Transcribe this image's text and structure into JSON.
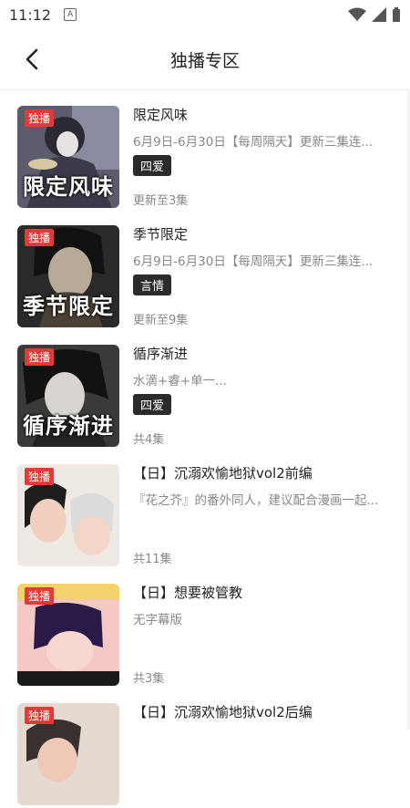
{
  "status": {
    "time": "11:12",
    "a_icon": "A"
  },
  "header": {
    "title": "独播专区"
  },
  "items": [
    {
      "badge": "独播",
      "cover_text": "限定风味",
      "name": "限定风味",
      "desc": "6月9日-6月30日【每周隔天】更新三集连...",
      "tag": "四爱",
      "meta": "更新至3集",
      "colors": [
        "#6d6d7f",
        "#2c2c36",
        "#e6e6ec"
      ]
    },
    {
      "badge": "独播",
      "cover_text": "季节限定",
      "name": "季节限定",
      "desc": "6月9日-6月30日【每周隔天】更新三集连...",
      "tag": "言情",
      "meta": "更新至9集",
      "colors": [
        "#3a3a3a",
        "#1a1a1a",
        "#a89a88"
      ]
    },
    {
      "badge": "独播",
      "cover_text": "循序渐进",
      "name": "循序渐进",
      "desc": "水滴+睿+单一...",
      "tag": "四爱",
      "meta": "共4集",
      "colors": [
        "#3f3f3f",
        "#151515",
        "#d8d8d8"
      ]
    },
    {
      "badge": "独播",
      "cover_text": "",
      "name": "【日】沉溺欢愉地狱vol2前编",
      "desc": "『花之芥』的番外同人，建议配合漫画一起...",
      "tag": "",
      "meta": "共11集",
      "colors": [
        "#e8e2dc",
        "#2a2a2a",
        "#f2c9b8"
      ]
    },
    {
      "badge": "独播",
      "cover_text": "",
      "name": "【日】想要被管教",
      "desc": "无字幕版",
      "tag": "",
      "meta": "共3集",
      "colors": [
        "#f3c6c2",
        "#2a1a4a",
        "#f7e08a"
      ]
    },
    {
      "badge": "独播",
      "cover_text": "",
      "name": "【日】沉溺欢愉地狱vol2后编",
      "desc": "",
      "tag": "",
      "meta": "",
      "colors": [
        "#e4dad2",
        "#3a3030",
        "#f0c0b0"
      ]
    }
  ]
}
